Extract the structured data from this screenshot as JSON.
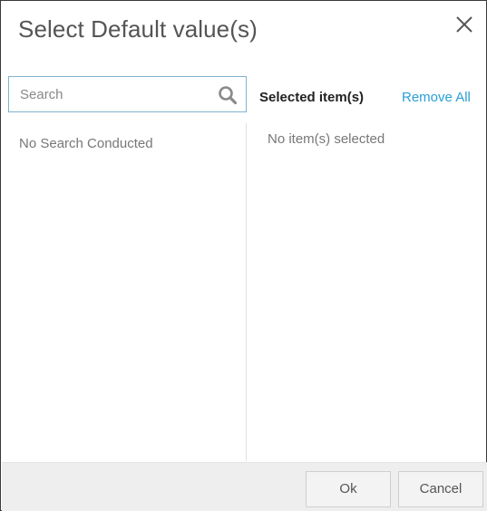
{
  "dialog": {
    "title": "Select Default value(s)",
    "close_icon": "close-icon"
  },
  "search": {
    "placeholder": "Search",
    "value": "",
    "icon": "search-icon",
    "empty_text": "No Search Conducted"
  },
  "selected": {
    "title": "Selected item(s)",
    "remove_all_label": "Remove All",
    "empty_text": "No item(s) selected"
  },
  "footer": {
    "ok_label": "Ok",
    "cancel_label": "Cancel"
  },
  "colors": {
    "accent_link": "#2a9fd6",
    "search_border": "#7fb3cf",
    "footer_bg": "#eeeeee"
  }
}
